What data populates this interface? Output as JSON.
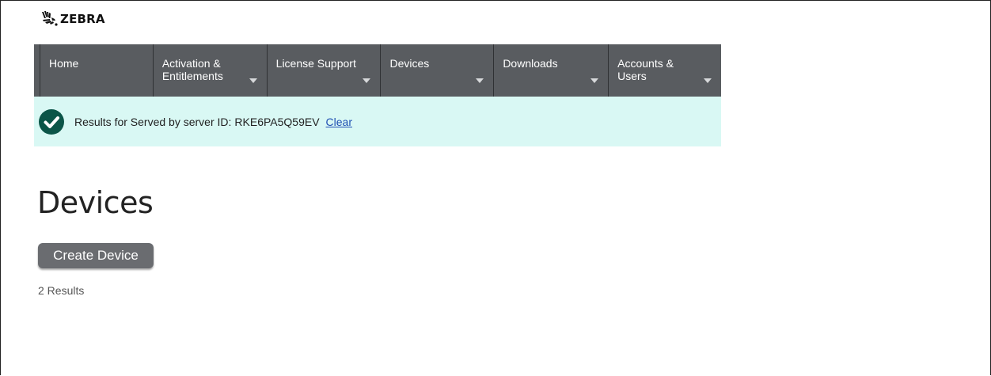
{
  "brand": {
    "logo_icon": "zebra-head-icon",
    "name": "ZEBRA"
  },
  "nav": {
    "items": [
      {
        "label": "Home",
        "has_dropdown": false
      },
      {
        "label": "Activation &\nEntitlements",
        "has_dropdown": true
      },
      {
        "label": "License Support",
        "has_dropdown": true
      },
      {
        "label": "Devices",
        "has_dropdown": true
      },
      {
        "label": "Downloads",
        "has_dropdown": true
      },
      {
        "label": "Accounts &\nUsers",
        "has_dropdown": true
      }
    ]
  },
  "banner": {
    "icon": "check-circle-icon",
    "text": "Results for Served by server ID:",
    "server_id": "RKE6PA5Q59EV",
    "clear_label": "Clear"
  },
  "page": {
    "title": "Devices",
    "create_button_label": "Create Device",
    "results_count": "2 Results"
  },
  "colors": {
    "nav_bg": "#595c60",
    "banner_bg": "#d9f8f4",
    "check_green": "#0b5548",
    "button_bg": "#6a6c70"
  }
}
